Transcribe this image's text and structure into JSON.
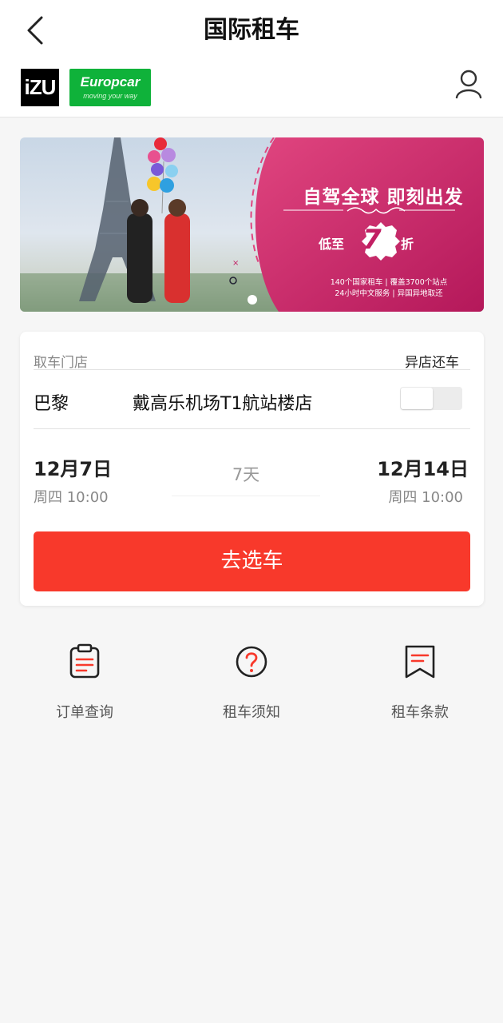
{
  "header": {
    "title": "国际租车",
    "logos": {
      "izu": "iZU",
      "europcar": "Europcar",
      "europcar_tagline": "moving your way"
    }
  },
  "banner": {
    "headline": "自驾全球  即刻出发",
    "discount_prefix": "低至",
    "discount_value": "7",
    "discount_suffix": "折",
    "line1": "140个国家租车 | 覆盖3700个站点",
    "line2": "24小时中文服务 | 异国异地取还",
    "active_slide": 1
  },
  "booking": {
    "pickup_label": "取车门店",
    "return_different_label": "异店还车",
    "return_different_enabled": false,
    "city": "巴黎",
    "store": "戴高乐机场T1航站楼店",
    "pickup_date": "12月7日",
    "pickup_time": "周四 10:00",
    "duration": "7天",
    "return_date": "12月14日",
    "return_time": "周四 10:00",
    "cta": "去选车"
  },
  "quick_links": [
    {
      "label": "订单查询",
      "icon": "clipboard-icon"
    },
    {
      "label": "租车须知",
      "icon": "question-circle-icon"
    },
    {
      "label": "租车条款",
      "icon": "bookmark-list-icon"
    }
  ],
  "colors": {
    "primary": "#f8392b",
    "europcar_green": "#0fb23a",
    "banner_magenta": "#c21f63"
  }
}
